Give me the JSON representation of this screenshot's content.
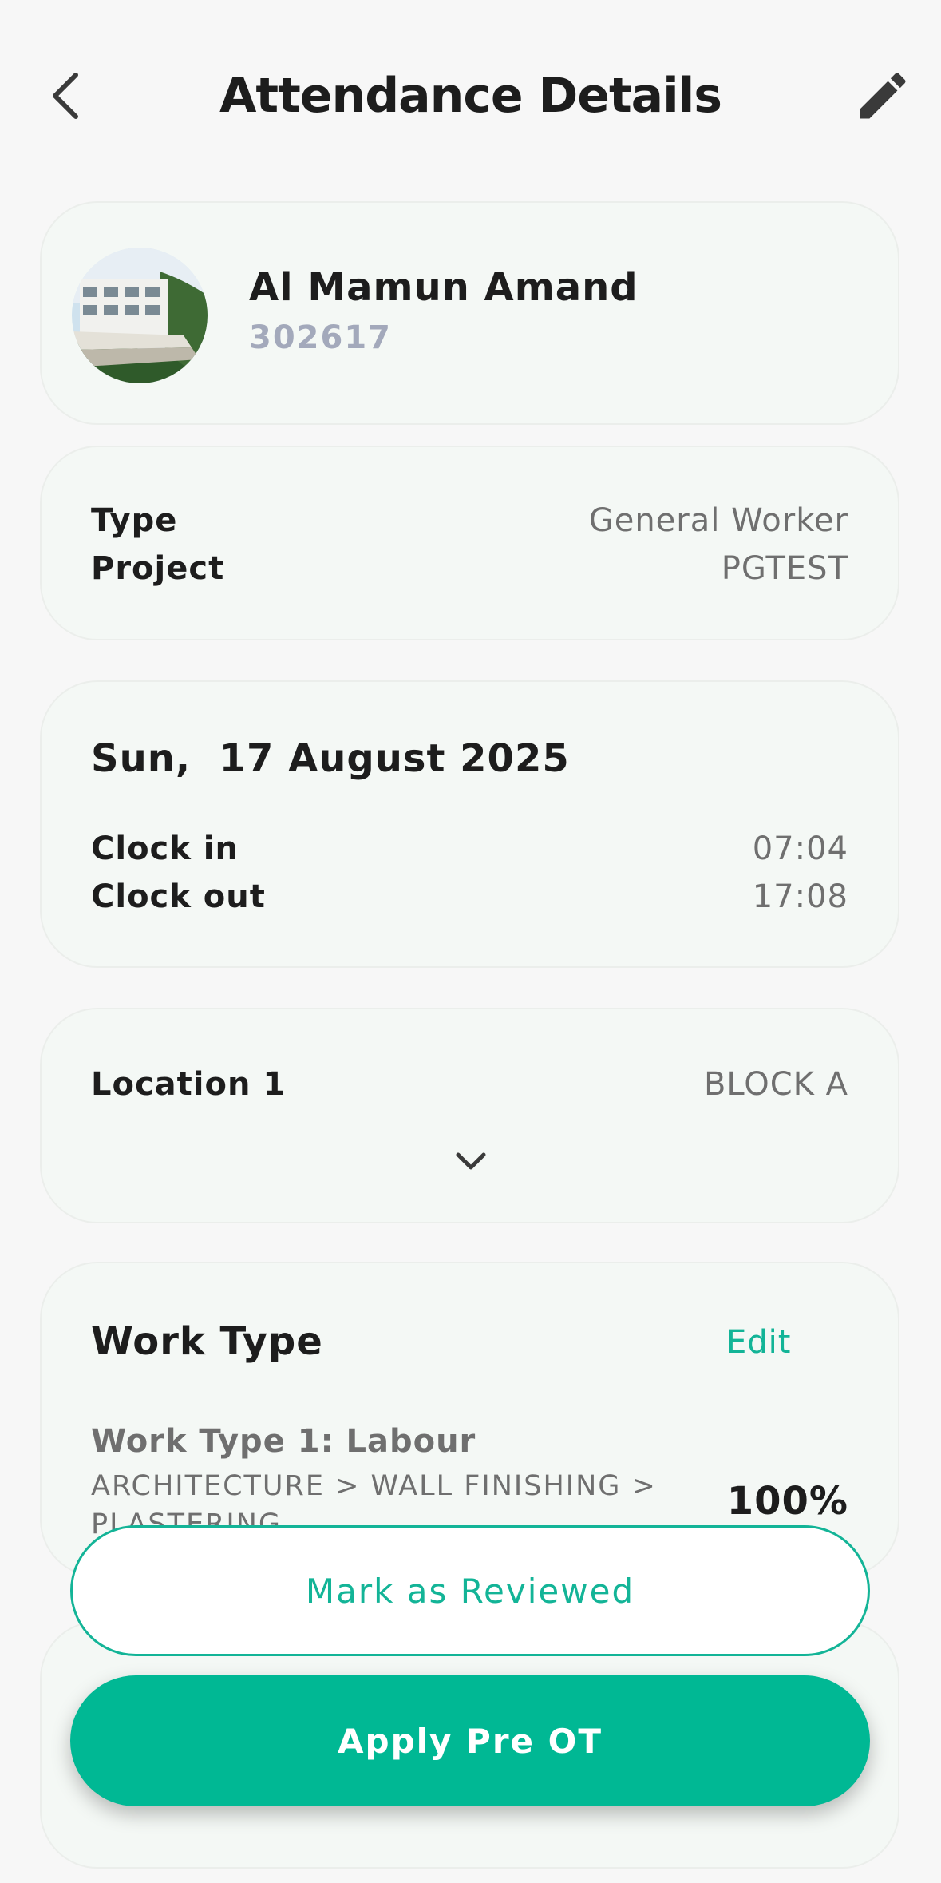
{
  "header": {
    "title": "Attendance Details"
  },
  "worker": {
    "name": "Al Mamun Amand",
    "id": "302617"
  },
  "info": {
    "type_label": "Type",
    "type_value": "General Worker",
    "project_label": "Project",
    "project_value": "PGTEST"
  },
  "attendance": {
    "date": "Sun,  17 August 2025",
    "clock_in_label": "Clock in",
    "clock_in_value": "07:04",
    "clock_out_label": "Clock out",
    "clock_out_value": "17:08"
  },
  "location": {
    "label": "Location 1",
    "value": "BLOCK A"
  },
  "work_type": {
    "title": "Work Type",
    "edit_label": "Edit",
    "items": [
      {
        "title": "Work Type 1: Labour",
        "path": "ARCHITECTURE > WALL FINISHING > PLASTERING",
        "percent": "100%"
      }
    ]
  },
  "actions": {
    "review_label": "Mark as Reviewed",
    "apply_label": "Apply Pre OT"
  },
  "colors": {
    "accent": "#00b894",
    "card_bg": "#f4f8f5"
  }
}
